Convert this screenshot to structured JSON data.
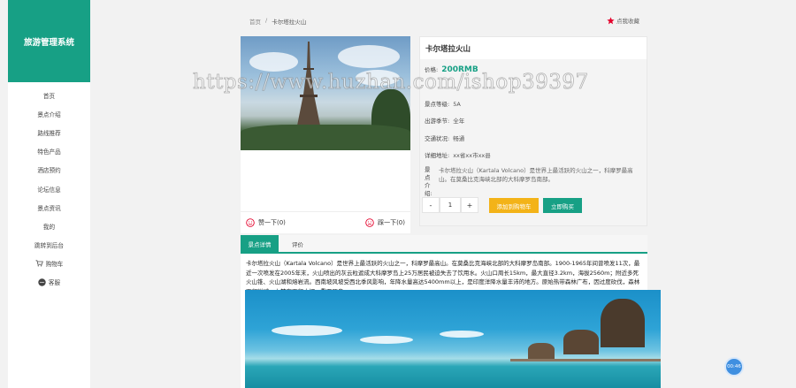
{
  "app": {
    "title": "旅游管理系统"
  },
  "sidebar": {
    "items": [
      {
        "label": "首页",
        "icon": ""
      },
      {
        "label": "景点介绍",
        "icon": ""
      },
      {
        "label": "路线推荐",
        "icon": ""
      },
      {
        "label": "特色产品",
        "icon": ""
      },
      {
        "label": "酒店预约",
        "icon": ""
      },
      {
        "label": "论坛信息",
        "icon": ""
      },
      {
        "label": "景点资讯",
        "icon": ""
      },
      {
        "label": "我的",
        "icon": ""
      },
      {
        "label": "跳转到后台",
        "icon": ""
      },
      {
        "label": "购物车",
        "icon": "cart-icon"
      },
      {
        "label": "客服",
        "icon": "chat-icon"
      }
    ]
  },
  "breadcrumb": {
    "home": "首页",
    "sep": "/",
    "current": "卡尔塔拉火山"
  },
  "favorite": {
    "label": "点我收藏",
    "color": "#e4002b"
  },
  "votes": {
    "up": "赞一下(0)",
    "down": "踩一下(0)"
  },
  "product": {
    "name": "卡尔塔拉火山",
    "price_label": "价格:",
    "price": "200RMB",
    "rating_label": "景点等级:",
    "rating": "5A",
    "season_label": "出游季节:",
    "season": "全年",
    "traffic_label": "交通状况:",
    "traffic": "畅通",
    "address_label": "详细地址:",
    "address": "xx省xx市xx县",
    "intro_label": "景点介绍:",
    "intro": "卡尔塔拉火山（Kartala Volcano）是世界上最活跃的火山之一，科摩罗最高山。在莫桑比克海峡北部的大科摩罗岛南部。"
  },
  "cart": {
    "minus": "-",
    "qty": "1",
    "plus": "+",
    "add_label": "添加到购物车",
    "buy_label": "立即购买"
  },
  "tabs": [
    {
      "label": "景点详情"
    },
    {
      "label": "评价"
    }
  ],
  "detail_text": "卡尔塔拉火山（Kartala Volcano）是世界上最活跃的火山之一，科摩罗最高山。在莫桑比克海峡北部的大科摩罗岛南部。1900-1965年间曾喷发11次，最近一次喷发在2005年末，火山喷出的灰云粒遮成大科摩罗岛上25万居民被迫失去了饮用水。火山口周长15km，最大直径3.2km，海拔2560m；附近多死火山锥、火山湖和熔岩流。西南坡风坡受西北季风影响，年降水量高达5400mm以上，是印度洋降水量丰沛的地方。原始热带森林广布，因过度砍伐，森林面积锐减。山麓有面积大椰、重要罗岛。",
  "watermark": "https://www.huzhan.com/ishop39397",
  "bubble": "00:46",
  "colors": {
    "accent": "#17a085",
    "cart_button": "#f3b318"
  }
}
